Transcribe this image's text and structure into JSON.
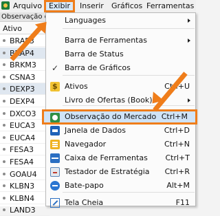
{
  "menubar": {
    "items": [
      "Arquivo",
      "Exibir",
      "Inserir",
      "Gráficos",
      "Ferramentas"
    ]
  },
  "panel": {
    "title": "Observação do Mercado",
    "header": "Ativo",
    "symbols": [
      "BRAP3",
      "BRAP4",
      "BRKM3",
      "CSNA3",
      "DEXP3",
      "DEXP4",
      "DXCO3",
      "EUCA3",
      "EUCA4",
      "FESA3",
      "FESA4",
      "GOAU4",
      "KLBN3",
      "KLBN4",
      "LAND3"
    ]
  },
  "menu": {
    "items": [
      {
        "label": "Languages",
        "submenu": true
      },
      {
        "label": "Barra de Ferramentas",
        "submenu": true
      },
      {
        "label": "Barra de Status"
      },
      {
        "label": "Barra de Gráficos",
        "checked": true
      },
      {
        "label": "Ativos",
        "shortcut": "Ctrl+U"
      },
      {
        "label": "Livro de Ofertas (Book)",
        "submenu": true
      },
      {
        "label": "Observação do Mercado",
        "shortcut": "Ctrl+M",
        "highlighted": true
      },
      {
        "label": "Janela de Dados",
        "shortcut": "Ctrl+D"
      },
      {
        "label": "Navegador",
        "shortcut": "Ctrl+N"
      },
      {
        "label": "Caixa de Ferramentas",
        "shortcut": "Ctrl+T"
      },
      {
        "label": "Testador de Estratégia",
        "shortcut": "Ctrl+R"
      },
      {
        "label": "Bate-papo",
        "shortcut": "Alt+M"
      },
      {
        "label": "Tela Cheia",
        "shortcut": "F11"
      }
    ]
  },
  "colors": {
    "highlight_border": "#ef7d1a",
    "highlight_fill": "#cfe3f7"
  }
}
